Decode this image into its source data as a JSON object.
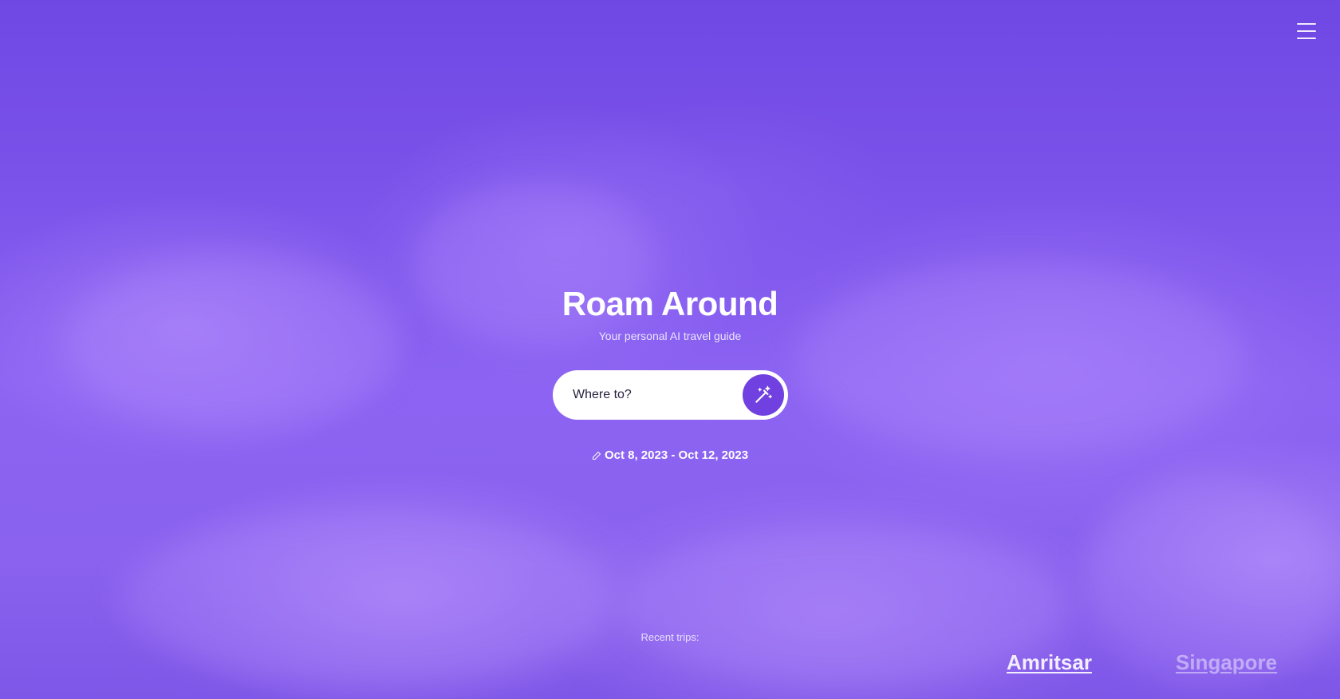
{
  "app": {
    "title": "Roam Around",
    "subtitle": "Your personal AI travel guide"
  },
  "header": {
    "menu_icon": "hamburger-menu-icon"
  },
  "search": {
    "placeholder": "Where to?",
    "value": "",
    "submit_icon": "magic-wand-icon"
  },
  "dates": {
    "icon": "pencil-icon",
    "label": "Oct 8, 2023 - Oct 12, 2023"
  },
  "recent": {
    "label": "Recent trips:",
    "trips": [
      {
        "name": "Amritsar"
      },
      {
        "name": "Singapore"
      }
    ]
  },
  "colors": {
    "background_top": "#6f47e3",
    "background_mid": "#8c63f2",
    "accent_button": "#7040e0",
    "search_bg": "#ffffff",
    "text_primary": "#ffffff"
  }
}
